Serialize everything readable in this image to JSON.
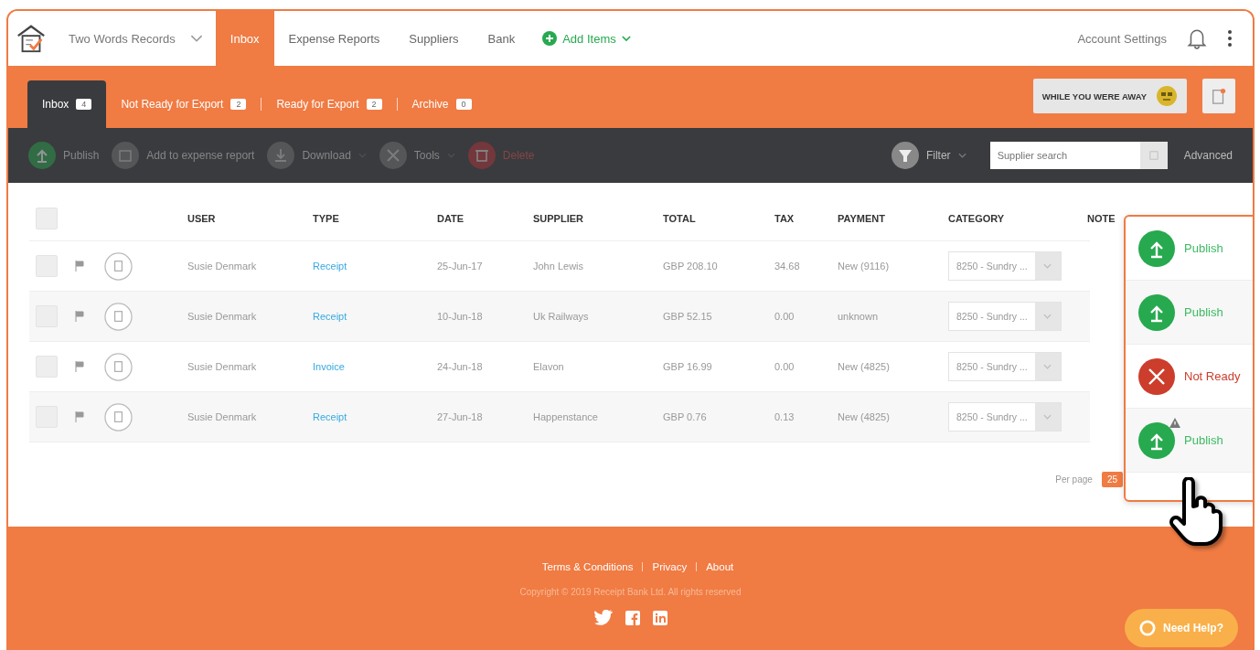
{
  "nav": {
    "company": "Two Words Records",
    "items": [
      {
        "label": "Inbox",
        "selected": true
      },
      {
        "label": "Expense Reports",
        "selected": false
      },
      {
        "label": "Suppliers",
        "selected": false
      },
      {
        "label": "Bank",
        "selected": false
      }
    ],
    "add_items": "Add Items",
    "account": "Account Settings"
  },
  "subtabs": [
    {
      "label": "Inbox",
      "count": "4",
      "selected": true
    },
    {
      "label": "Not Ready for Export",
      "count": "2",
      "selected": false
    },
    {
      "label": "Ready for Export",
      "count": "2",
      "selected": false
    },
    {
      "label": "Archive",
      "count": "0",
      "selected": false
    }
  ],
  "away_button": "WHILE YOU WERE AWAY",
  "toolbar": {
    "actions": [
      {
        "kind": "publish",
        "label": "Publish",
        "disabled": true,
        "caret": false
      },
      {
        "kind": "report",
        "label": "Add to expense report",
        "disabled": true,
        "caret": false
      },
      {
        "kind": "download",
        "label": "Download",
        "disabled": true,
        "caret": true
      },
      {
        "kind": "tools",
        "label": "Tools",
        "disabled": true,
        "caret": true
      },
      {
        "kind": "delete",
        "label": "Delete",
        "disabled": true,
        "caret": false
      }
    ],
    "filter": "Filter",
    "search": {
      "placeholder": "Supplier search"
    },
    "advanced": "Advanced"
  },
  "table": {
    "select_all_checked": false,
    "columns": [
      "USER",
      "TYPE",
      "DATE",
      "SUPPLIER",
      "TOTAL",
      "TAX",
      "PAYMENT",
      "CATEGORY",
      "NOTE"
    ],
    "rows": [
      {
        "checked": false,
        "user": "Susie Denmark",
        "type": "Receipt",
        "date": "25-Jun-17",
        "supplier": "John Lewis",
        "total": "GBP 208.10",
        "tax": "34.68",
        "payment": "New (9116)",
        "category": "8250 - Sundry ..."
      },
      {
        "checked": false,
        "user": "Susie Denmark",
        "type": "Receipt",
        "date": "10-Jun-18",
        "supplier": "Uk Railways",
        "total": "GBP 52.15",
        "tax": "0.00",
        "payment": "unknown",
        "category": "8250 - Sundry ..."
      },
      {
        "checked": false,
        "user": "Susie Denmark",
        "type": "Invoice",
        "date": "24-Jun-18",
        "supplier": "Elavon",
        "total": "GBP 16.99",
        "tax": "0.00",
        "payment": "New (4825)",
        "category": "8250 - Sundry ..."
      },
      {
        "checked": false,
        "user": "Susie Denmark",
        "type": "Receipt",
        "date": "27-Jun-18",
        "supplier": "Happenstance",
        "total": "GBP 0.76",
        "tax": "0.13",
        "payment": "New (4825)",
        "category": "8250 - Sundry ..."
      }
    ]
  },
  "per_page": {
    "label": "Per page",
    "value": "25"
  },
  "status_popup": [
    {
      "kind": "publish",
      "label": "Publish",
      "warning": false
    },
    {
      "kind": "publish",
      "label": "Publish",
      "warning": false
    },
    {
      "kind": "not_ready",
      "label": "Not Ready",
      "warning": false
    },
    {
      "kind": "publish",
      "label": "Publish",
      "warning": true
    }
  ],
  "footer": {
    "links": [
      "Terms & Conditions",
      "Privacy",
      "About"
    ],
    "copyright": "Copyright © 2019 Receipt Bank Ltd. All rights reserved"
  },
  "help_button": "Need Help?"
}
